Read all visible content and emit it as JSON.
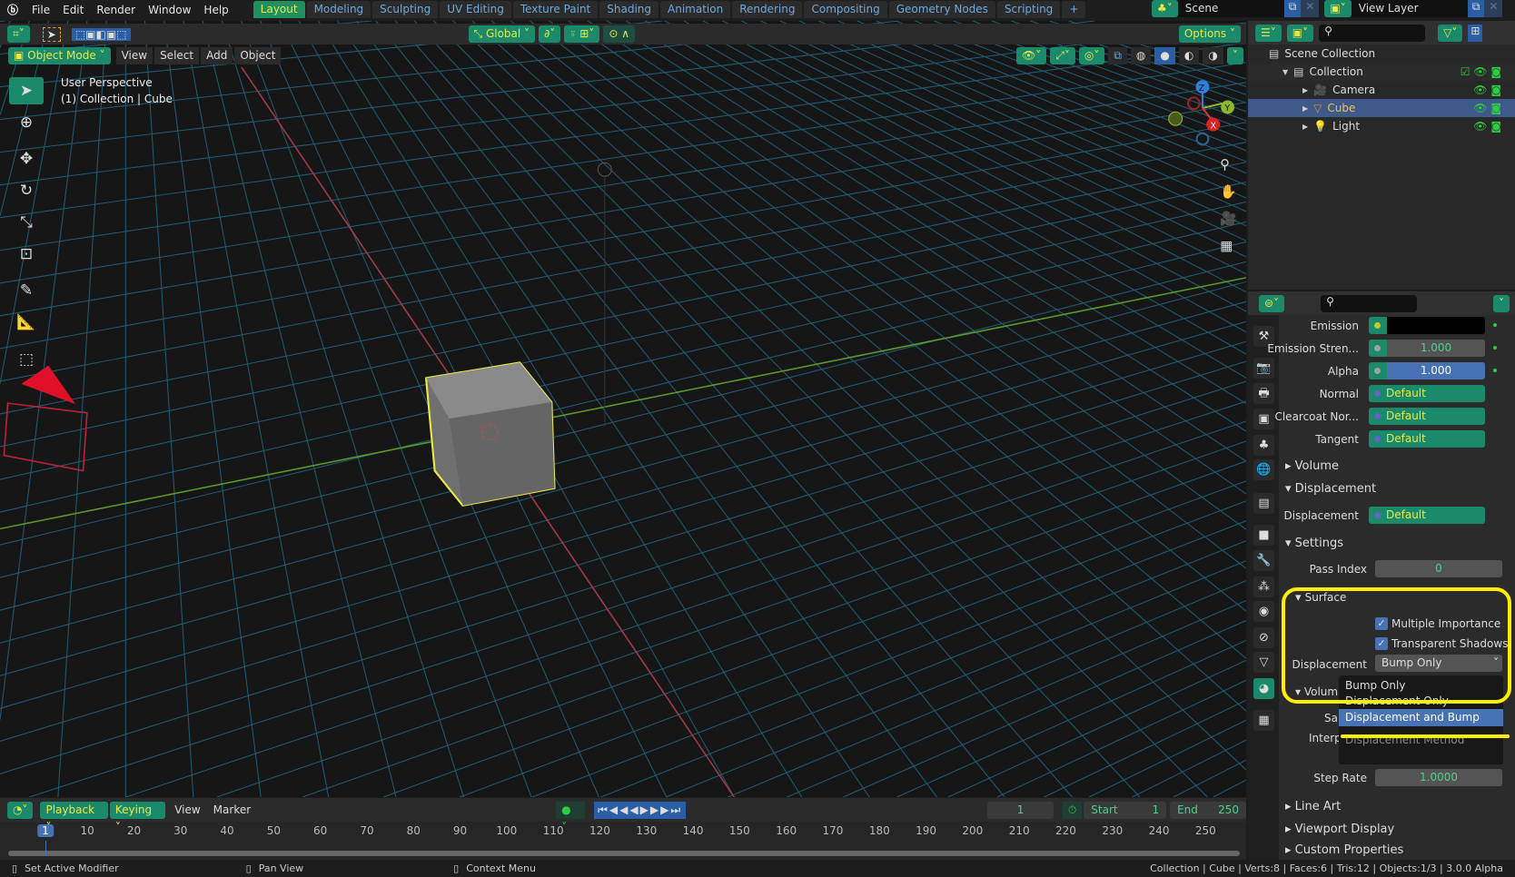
{
  "topbar": {
    "menus": [
      "File",
      "Edit",
      "Render",
      "Window",
      "Help"
    ],
    "workspaces": [
      "Layout",
      "Modeling",
      "Sculpting",
      "UV Editing",
      "Texture Paint",
      "Shading",
      "Animation",
      "Rendering",
      "Compositing",
      "Geometry Nodes",
      "Scripting"
    ],
    "active_workspace": "Layout",
    "add_tab": "+",
    "scene": "Scene",
    "view_layer": "View Layer"
  },
  "tool_header": {
    "orientation": "Global",
    "options": "Options"
  },
  "viewport": {
    "mode": "Object Mode",
    "menus": [
      "View",
      "Select",
      "Add",
      "Object"
    ],
    "info_line1": "User Perspective",
    "info_line2": "(1) Collection | Cube",
    "gizmo_axes": [
      "X",
      "Y",
      "Z"
    ]
  },
  "outliner": {
    "items": [
      {
        "label": "Scene Collection",
        "icon": "scene-collection-icon"
      },
      {
        "label": "Collection",
        "icon": "collection-icon"
      },
      {
        "label": "Camera",
        "icon": "camera-icon"
      },
      {
        "label": "Cube",
        "icon": "mesh-icon",
        "selected": true
      },
      {
        "label": "Light",
        "icon": "light-icon"
      }
    ]
  },
  "properties": {
    "rows": [
      {
        "label": "Emission",
        "value": "",
        "type": "color"
      },
      {
        "label": "Emission Stren...",
        "value": "1.000",
        "type": "number"
      },
      {
        "label": "Alpha",
        "value": "1.000",
        "type": "slider",
        "fraction": 1.0
      },
      {
        "label": "Normal",
        "value": "Default",
        "type": "link"
      },
      {
        "label": "Clearcoat Nor...",
        "value": "Default",
        "type": "link"
      },
      {
        "label": "Tangent",
        "value": "Default",
        "type": "link"
      }
    ],
    "panels": {
      "volume": "Volume",
      "displacement": "Displacement",
      "settings": "Settings",
      "surface": "Surface",
      "volume_sub": "Volum",
      "line_art": "Line Art",
      "viewport_display": "Viewport Display",
      "custom_properties": "Custom Properties"
    },
    "displacement_label": "Displacement",
    "displacement_value": "Default",
    "pass_index_label": "Pass Index",
    "pass_index": "0",
    "multiple_importance": "Multiple Importance",
    "transparent_shadows": "Transparent Shadows",
    "surface_displacement_label": "Displacement",
    "surface_displacement_value": "Bump Only",
    "sampling_partial": "Sa",
    "interp_partial": "Interp",
    "step_rate_label": "Step Rate",
    "step_rate": "1.0000",
    "dropdown": {
      "options": [
        "Bump Only",
        "Displacement Only",
        "Displacement and Bump"
      ],
      "highlighted": "Displacement and Bump",
      "title": "Displacement Method"
    }
  },
  "timeline": {
    "menus": [
      "Playback",
      "Keying",
      "View",
      "Marker"
    ],
    "current_frame": "1",
    "start_label": "Start",
    "start": "1",
    "end_label": "End",
    "end": "250",
    "ticks": [
      "1",
      "10",
      "20",
      "30",
      "40",
      "50",
      "60",
      "70",
      "80",
      "90",
      "100",
      "110",
      "120",
      "130",
      "140",
      "150",
      "160",
      "170",
      "180",
      "190",
      "200",
      "210",
      "220",
      "230",
      "240",
      "250"
    ]
  },
  "statusbar": {
    "left": [
      "Set Active Modifier",
      "Pan View",
      "Context Menu"
    ],
    "right": "Collection | Cube | Verts:8 | Faces:6 | Tris:12 | Objects:1/3 | 3.0.0 Alpha"
  },
  "colors": {
    "accent_green": "#1a8a6a",
    "highlight_yellow": "#e8e84a",
    "selection_blue": "#4772b3",
    "annotation": "#ffee00"
  }
}
